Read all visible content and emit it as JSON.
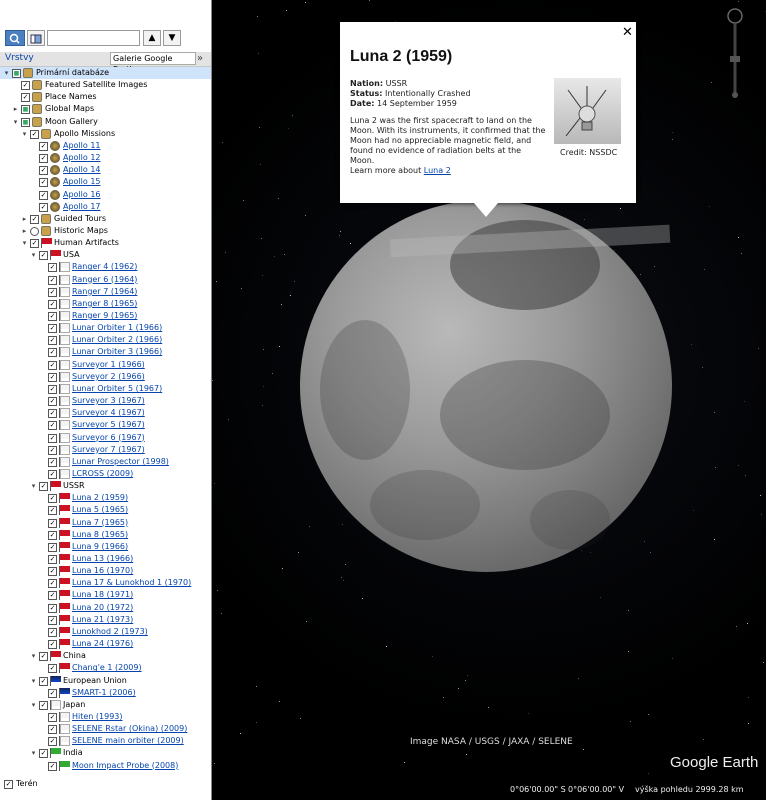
{
  "panel": {
    "layers_title": "Vrstvy",
    "gallery_button": "Galerie Google Earth",
    "gallery_chevron": "»",
    "search_value": "",
    "up_arrow": "▲",
    "down_arrow": "▼",
    "terrain_label": "Terén",
    "tree": [
      {
        "label": "Primární databáze",
        "indent": 0,
        "check": "partial",
        "icon": "globe-icon",
        "selected": true,
        "expand": "-",
        "link": false
      },
      {
        "label": "Featured Satellite Images",
        "indent": 1,
        "check": "checked",
        "icon": "satellite-images-icon",
        "link": false
      },
      {
        "label": "Place Names",
        "indent": 1,
        "check": "checked",
        "icon": "place-names-icon",
        "link": false
      },
      {
        "label": "Global Maps",
        "indent": 1,
        "check": "partial",
        "icon": "global-maps-icon",
        "expand": "+",
        "link": false
      },
      {
        "label": "Moon Gallery",
        "indent": 1,
        "check": "partial",
        "icon": "moon-gallery-icon",
        "expand": "-",
        "link": false
      },
      {
        "label": "Apollo Missions",
        "indent": 2,
        "check": "checked",
        "icon": "apollo-icon",
        "expand": "-",
        "link": false
      },
      {
        "label": "Apollo 11",
        "indent": 3,
        "check": "checked",
        "icon": "patch-icon",
        "link": true
      },
      {
        "label": "Apollo 12",
        "indent": 3,
        "check": "checked",
        "icon": "patch-icon",
        "link": true
      },
      {
        "label": "Apollo 14",
        "indent": 3,
        "check": "checked",
        "icon": "patch-icon",
        "link": true
      },
      {
        "label": "Apollo 15",
        "indent": 3,
        "check": "checked",
        "icon": "patch-icon",
        "link": true
      },
      {
        "label": "Apollo 16",
        "indent": 3,
        "check": "checked",
        "icon": "patch-icon",
        "link": true
      },
      {
        "label": "Apollo 17",
        "indent": 3,
        "check": "checked",
        "icon": "patch-icon",
        "link": true
      },
      {
        "label": "Guided Tours",
        "indent": 2,
        "check": "checked",
        "icon": "tours-icon",
        "expand": "+",
        "link": false
      },
      {
        "label": "Historic Maps",
        "indent": 2,
        "check": "radio",
        "icon": "historic-map-icon",
        "expand": "+",
        "link": false
      },
      {
        "label": "Human Artifacts",
        "indent": 2,
        "check": "checked",
        "icon": "flag-red",
        "expand": "-",
        "link": false
      },
      {
        "label": "USA",
        "indent": 3,
        "check": "checked",
        "icon": "flag-red",
        "expand": "-",
        "link": false
      },
      {
        "label": "Ranger 4 (1962)",
        "indent": 4,
        "check": "checked",
        "icon": "flag-white",
        "link": true
      },
      {
        "label": "Ranger 6 (1964)",
        "indent": 4,
        "check": "checked",
        "icon": "flag-white",
        "link": true
      },
      {
        "label": "Ranger 7 (1964)",
        "indent": 4,
        "check": "checked",
        "icon": "flag-white",
        "link": true
      },
      {
        "label": "Ranger 8 (1965)",
        "indent": 4,
        "check": "checked",
        "icon": "flag-white",
        "link": true
      },
      {
        "label": "Ranger 9 (1965)",
        "indent": 4,
        "check": "checked",
        "icon": "flag-white",
        "link": true
      },
      {
        "label": "Lunar Orbiter 1 (1966)",
        "indent": 4,
        "check": "checked",
        "icon": "flag-white",
        "link": true
      },
      {
        "label": "Lunar Orbiter 2 (1966)",
        "indent": 4,
        "check": "checked",
        "icon": "flag-white",
        "link": true
      },
      {
        "label": "Lunar Orbiter 3 (1966)",
        "indent": 4,
        "check": "checked",
        "icon": "flag-white",
        "link": true
      },
      {
        "label": "Surveyor 1 (1966)",
        "indent": 4,
        "check": "checked",
        "icon": "flag-white",
        "link": true
      },
      {
        "label": "Surveyor 2 (1966)",
        "indent": 4,
        "check": "checked",
        "icon": "flag-white",
        "link": true
      },
      {
        "label": "Lunar Orbiter 5 (1967)",
        "indent": 4,
        "check": "checked",
        "icon": "flag-white",
        "link": true
      },
      {
        "label": "Surveyor 3 (1967)",
        "indent": 4,
        "check": "checked",
        "icon": "flag-white",
        "link": true
      },
      {
        "label": "Surveyor 4 (1967)",
        "indent": 4,
        "check": "checked",
        "icon": "flag-white",
        "link": true
      },
      {
        "label": "Surveyor 5 (1967)",
        "indent": 4,
        "check": "checked",
        "icon": "flag-white",
        "link": true
      },
      {
        "label": "Surveyor 6 (1967)",
        "indent": 4,
        "check": "checked",
        "icon": "flag-white",
        "link": true
      },
      {
        "label": "Surveyor 7 (1967)",
        "indent": 4,
        "check": "checked",
        "icon": "flag-white",
        "link": true
      },
      {
        "label": "Lunar Prospector (1998)",
        "indent": 4,
        "check": "checked",
        "icon": "flag-white",
        "link": true
      },
      {
        "label": "LCROSS (2009)",
        "indent": 4,
        "check": "checked",
        "icon": "flag-white",
        "link": true
      },
      {
        "label": "USSR",
        "indent": 3,
        "check": "checked",
        "icon": "flag-red",
        "expand": "-",
        "link": false
      },
      {
        "label": "Luna 2 (1959)",
        "indent": 4,
        "check": "checked",
        "icon": "flag-red",
        "link": true
      },
      {
        "label": "Luna 5 (1965)",
        "indent": 4,
        "check": "checked",
        "icon": "flag-red",
        "link": true
      },
      {
        "label": "Luna 7 (1965)",
        "indent": 4,
        "check": "checked",
        "icon": "flag-red",
        "link": true
      },
      {
        "label": "Luna 8 (1965)",
        "indent": 4,
        "check": "checked",
        "icon": "flag-red",
        "link": true
      },
      {
        "label": "Luna 9 (1966)",
        "indent": 4,
        "check": "checked",
        "icon": "flag-red",
        "link": true
      },
      {
        "label": "Luna 13 (1966)",
        "indent": 4,
        "check": "checked",
        "icon": "flag-red",
        "link": true
      },
      {
        "label": "Luna 16 (1970)",
        "indent": 4,
        "check": "checked",
        "icon": "flag-red",
        "link": true
      },
      {
        "label": "Luna 17 & Lunokhod 1 (1970)",
        "indent": 4,
        "check": "checked",
        "icon": "flag-red",
        "link": true
      },
      {
        "label": "Luna 18 (1971)",
        "indent": 4,
        "check": "checked",
        "icon": "flag-red",
        "link": true
      },
      {
        "label": "Luna 20 (1972)",
        "indent": 4,
        "check": "checked",
        "icon": "flag-red",
        "link": true
      },
      {
        "label": "Luna 21 (1973)",
        "indent": 4,
        "check": "checked",
        "icon": "flag-red",
        "link": true
      },
      {
        "label": "Lunokhod 2 (1973)",
        "indent": 4,
        "check": "checked",
        "icon": "flag-red",
        "link": true
      },
      {
        "label": "Luna 24 (1976)",
        "indent": 4,
        "check": "checked",
        "icon": "flag-red",
        "link": true
      },
      {
        "label": "China",
        "indent": 3,
        "check": "checked",
        "icon": "flag-red",
        "expand": "-",
        "link": false
      },
      {
        "label": "Chang'e 1 (2009)",
        "indent": 4,
        "check": "checked",
        "icon": "flag-red",
        "link": true
      },
      {
        "label": "European Union",
        "indent": 3,
        "check": "checked",
        "icon": "flag-blue",
        "expand": "-",
        "link": false
      },
      {
        "label": "SMART-1 (2006)",
        "indent": 4,
        "check": "checked",
        "icon": "flag-blue",
        "link": true
      },
      {
        "label": "Japan",
        "indent": 3,
        "check": "checked",
        "icon": "flag-white",
        "expand": "-",
        "link": false
      },
      {
        "label": "Hiten (1993)",
        "indent": 4,
        "check": "checked",
        "icon": "flag-white",
        "link": true
      },
      {
        "label": "SELENE Rstar (Okina) (2009)",
        "indent": 4,
        "check": "checked",
        "icon": "flag-white",
        "link": true
      },
      {
        "label": "SELENE main orbiter (2009)",
        "indent": 4,
        "check": "checked",
        "icon": "flag-white",
        "link": true
      },
      {
        "label": "India",
        "indent": 3,
        "check": "checked",
        "icon": "flag-green",
        "expand": "-",
        "link": false
      },
      {
        "label": "Moon Impact Probe (2008)",
        "indent": 4,
        "check": "checked",
        "icon": "flag-green",
        "link": true
      }
    ]
  },
  "popup": {
    "title": "Luna 2 (1959)",
    "close": "✕",
    "nation_label": "Nation:",
    "nation": "USSR",
    "status_label": "Status:",
    "status": "Intentionally Crashed",
    "date_label": "Date:",
    "date": "14 September 1959",
    "description": "Luna 2 was the first spacecraft to land on the Moon. With its instruments, it confirmed that the Moon had no appreciable magnetic field, and found no evidence of radiation belts at the Moon.",
    "learn_more_prefix": "Learn more about ",
    "learn_more_link": "Luna 2",
    "image_credit": "Credit: NSSDC"
  },
  "map": {
    "image_credit": "Image NASA / USGS / JAXA / SELENE",
    "logo": "Google Earth",
    "lat": "0°06'00.00\" S",
    "lon": "0°06'00.00\" V",
    "altitude": "výška pohledu 2999.28 km"
  }
}
